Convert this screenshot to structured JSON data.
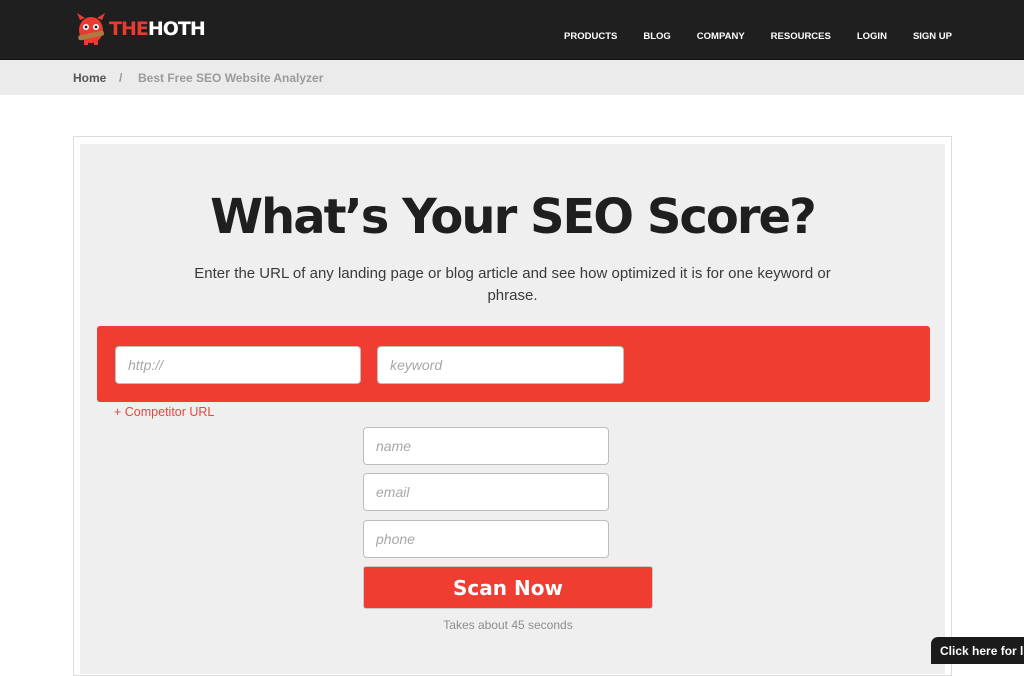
{
  "brand": {
    "logo_the": "THE",
    "logo_hoth": "HOTH",
    "accent_color": "#ef3d32"
  },
  "nav": {
    "items": [
      {
        "label": "PRODUCTS"
      },
      {
        "label": "BLOG"
      },
      {
        "label": "COMPANY"
      },
      {
        "label": "RESOURCES"
      },
      {
        "label": "LOGIN"
      },
      {
        "label": "SIGN UP"
      }
    ]
  },
  "breadcrumb": {
    "home": "Home",
    "separator": "/",
    "current": "Best Free SEO Website Analyzer"
  },
  "hero": {
    "title": "What’s Your SEO Score?",
    "subtitle": "Enter the URL of any landing page or blog article and see how optimized it is for one keyword or phrase."
  },
  "form": {
    "url_placeholder": "http://",
    "keyword_placeholder": "keyword",
    "competitor_link": "+ Competitor URL",
    "name_placeholder": "name",
    "email_placeholder": "email",
    "phone_placeholder": "phone",
    "submit_label": "Scan Now",
    "note": "Takes about 45 seconds"
  },
  "chat": {
    "label": "Click here for live chat"
  }
}
